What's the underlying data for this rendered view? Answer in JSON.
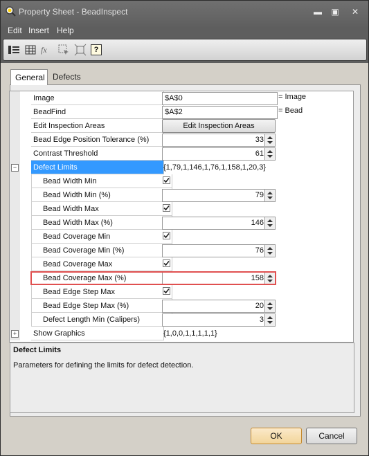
{
  "window": {
    "title": "Property Sheet - BeadInspect",
    "controls": {
      "minimize": "▬",
      "maximize": "▣",
      "close": "✕"
    }
  },
  "menu": [
    "Edit",
    "Insert",
    "Help"
  ],
  "toolbar": [
    {
      "icon": "categorized-icon"
    },
    {
      "icon": "alphabetical-icon"
    },
    {
      "icon": "function-icon",
      "text": "fx"
    },
    {
      "icon": "select-region-icon"
    },
    {
      "icon": "fit-region-icon"
    },
    {
      "icon": "help-icon",
      "text": "?"
    }
  ],
  "tabs": {
    "general": "General",
    "defects": "Defects"
  },
  "grid": {
    "image": {
      "label": "Image",
      "value": "$A$0",
      "suffix": "= Image"
    },
    "beadfind": {
      "label": "BeadFind",
      "value": "$A$2",
      "suffix": "= Bead"
    },
    "edit_areas": {
      "label": "Edit Inspection Areas",
      "button": "Edit Inspection Areas"
    },
    "edge_tol": {
      "label": "Bead Edge Position Tolerance (%)",
      "value": "33"
    },
    "contrast": {
      "label": "Contrast Threshold",
      "value": "61"
    },
    "defect_limits": {
      "label": "Defect Limits",
      "value": "{1,79,1,146,1,76,1,158,1,20,3}",
      "expander": "−"
    },
    "width_min": {
      "label": "Bead Width Min",
      "checked": true
    },
    "width_min_pct": {
      "label": "Bead Width Min (%)",
      "value": "79"
    },
    "width_max": {
      "label": "Bead Width Max",
      "checked": true
    },
    "width_max_pct": {
      "label": "Bead Width Max (%)",
      "value": "146"
    },
    "cov_min": {
      "label": "Bead Coverage Min",
      "checked": true
    },
    "cov_min_pct": {
      "label": "Bead Coverage Min (%)",
      "value": "76"
    },
    "cov_max": {
      "label": "Bead Coverage Max",
      "checked": true
    },
    "cov_max_pct": {
      "label": "Bead Coverage Max (%)",
      "value": "158"
    },
    "step_max": {
      "label": "Bead Edge Step Max",
      "checked": true
    },
    "step_max_pct": {
      "label": "Bead Edge Step Max (%)",
      "value": "20"
    },
    "defect_len": {
      "label": "Defect Length Min (Calipers)",
      "value": "3"
    },
    "show_graphics": {
      "label": "Show Graphics",
      "value": "{1,0,0,1,1,1,1,1}",
      "expander": "+"
    }
  },
  "description": {
    "title": "Defect Limits",
    "body": "Parameters for defining the limits for defect detection."
  },
  "buttons": {
    "ok": "OK",
    "cancel": "Cancel"
  },
  "colors": {
    "selection": "#3399ff",
    "highlight_box": "#e05050",
    "ok_button": "#f2d59a"
  }
}
